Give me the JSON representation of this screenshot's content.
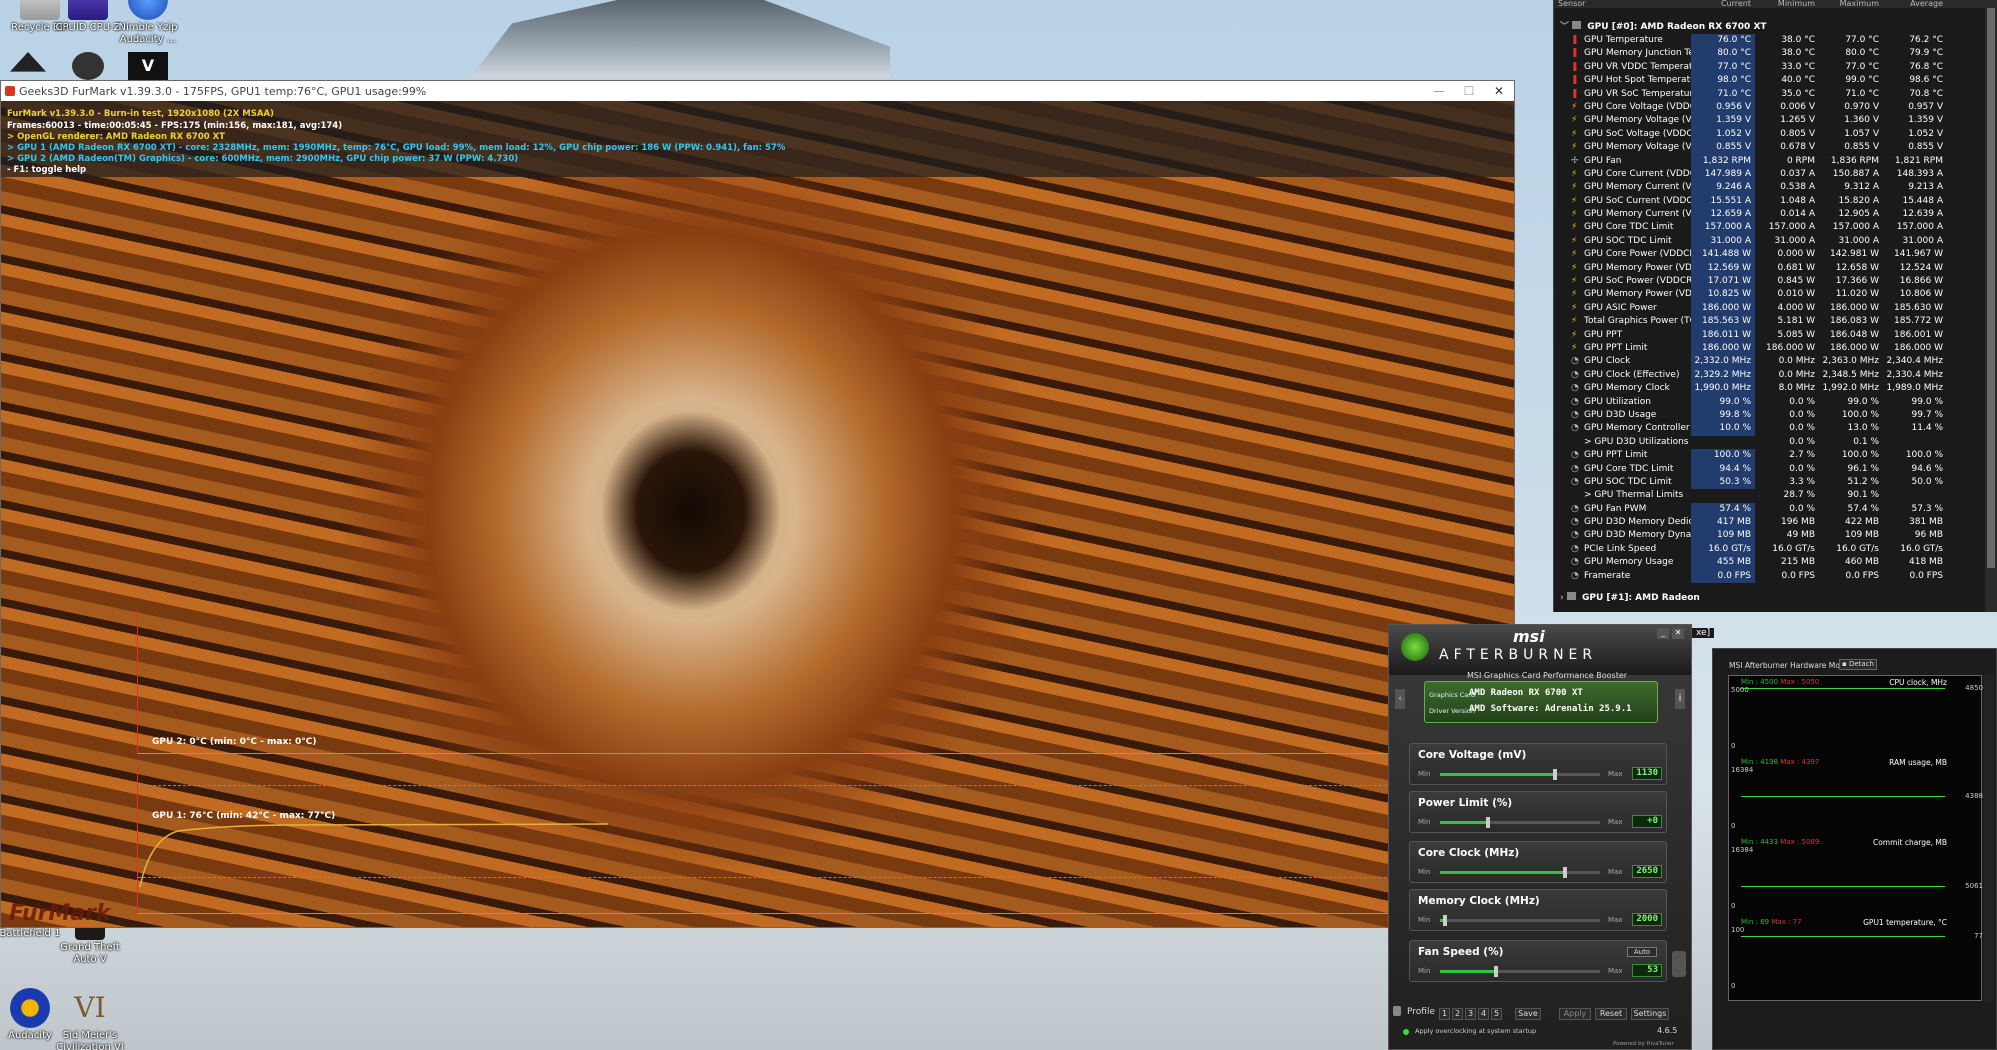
{
  "desktop": {
    "icons": [
      {
        "label": "Recycle Bin"
      },
      {
        "label": "CPUID CPU-Z"
      },
      {
        "label": "Nimble Yzip Audacity ..."
      },
      {
        "label": "Battlefield 1"
      },
      {
        "label": "Grand Theft Auto V"
      },
      {
        "label": "Audacity"
      },
      {
        "label": "Sid Meier's Civilization VI"
      }
    ]
  },
  "furmark": {
    "title": "Geeks3D FurMark v1.39.3.0 - 175FPS, GPU1 temp:76°C, GPU1 usage:99%",
    "osd": [
      {
        "text": "FurMark v1.39.3.0 - Burn-in test, 1920x1080 (2X MSAA)",
        "color": "#f2d230"
      },
      {
        "text": "Frames:60013 - time:00:05:45 - FPS:175 (min:156, max:181, avg:174)",
        "color": "#ffffff"
      },
      {
        "text": "> OpenGL renderer: AMD Radeon RX 6700 XT",
        "color": "#f2d230"
      },
      {
        "text": "> GPU 1 (AMD Radeon RX 6700 XT) - core: 2328MHz, mem: 1990MHz, temp: 76°C, GPU load: 99%, mem load: 12%, GPU chip power: 186 W (PPW: 0.941), fan: 57%",
        "color": "#33c8f0"
      },
      {
        "text": "> GPU 2 (AMD Radeon(TM) Graphics) - core: 600MHz, mem: 2900MHz, GPU chip power: 37 W (PPW: 4.730)",
        "color": "#33c8f0"
      },
      {
        "text": "- F1: toggle help",
        "color": "#ffffff"
      }
    ],
    "graph_gpu2_label": "GPU 2: 0°C (min: 0°C - max: 0°C)",
    "graph_gpu1_label": "GPU 1: 76°C (min: 42°C - max: 77°C)",
    "logo_text": "FurMark"
  },
  "hwinfo": {
    "columns": [
      "Sensor",
      "Current",
      "Minimum",
      "Maximum",
      "Average"
    ],
    "group0": "GPU [#0]: AMD Radeon RX 6700 XT",
    "group1": "GPU [#1]: AMD Radeon",
    "rows": [
      [
        "GPU Temperature",
        "76.0 °C",
        "38.0 °C",
        "77.0 °C",
        "76.2 °C",
        "temp"
      ],
      [
        "GPU Memory Junction Temp...",
        "80.0 °C",
        "38.0 °C",
        "80.0 °C",
        "79.9 °C",
        "temp"
      ],
      [
        "GPU VR VDDC Temperature",
        "77.0 °C",
        "33.0 °C",
        "77.0 °C",
        "76.8 °C",
        "temp"
      ],
      [
        "GPU Hot Spot Temperature",
        "98.0 °C",
        "40.0 °C",
        "99.0 °C",
        "98.6 °C",
        "temp"
      ],
      [
        "GPU VR SoC Temperature",
        "71.0 °C",
        "35.0 °C",
        "71.0 °C",
        "70.8 °C",
        "temp"
      ],
      [
        "GPU Core Voltage (VDDCR_...",
        "0.956 V",
        "0.006 V",
        "0.970 V",
        "0.957 V",
        "volt"
      ],
      [
        "GPU Memory Voltage (VDDIO)",
        "1.359 V",
        "1.265 V",
        "1.360 V",
        "1.359 V",
        "volt"
      ],
      [
        "GPU SoC Voltage (VDDCR_S...",
        "1.052 V",
        "0.805 V",
        "1.057 V",
        "1.052 V",
        "volt"
      ],
      [
        "GPU Memory Voltage (VDDCI...",
        "0.855 V",
        "0.678 V",
        "0.855 V",
        "0.855 V",
        "volt"
      ],
      [
        "GPU Fan",
        "1,832 RPM",
        "0 RPM",
        "1,836 RPM",
        "1,821 RPM",
        "fan"
      ],
      [
        "GPU Core Current (VDDCR_...",
        "147.989 A",
        "0.037 A",
        "150.887 A",
        "148.393 A",
        "volt"
      ],
      [
        "GPU Memory Current (VDDIO)",
        "9.246 A",
        "0.538 A",
        "9.312 A",
        "9.213 A",
        "volt"
      ],
      [
        "GPU SoC Current (VDDCR_S...",
        "15.551 A",
        "1.048 A",
        "15.820 A",
        "15.448 A",
        "volt"
      ],
      [
        "GPU Memory Current (VDDC...",
        "12.659 A",
        "0.014 A",
        "12.905 A",
        "12.639 A",
        "volt"
      ],
      [
        "GPU Core TDC Limit",
        "157.000 A",
        "157.000 A",
        "157.000 A",
        "157.000 A",
        "volt"
      ],
      [
        "GPU SOC TDC Limit",
        "31.000 A",
        "31.000 A",
        "31.000 A",
        "31.000 A",
        "volt"
      ],
      [
        "GPU Core Power (VDDCR_GFX)",
        "141.488 W",
        "0.000 W",
        "142.981 W",
        "141.967 W",
        "volt"
      ],
      [
        "GPU Memory Power (VDDIO)",
        "12.569 W",
        "0.681 W",
        "12.658 W",
        "12.524 W",
        "volt"
      ],
      [
        "GPU SoC Power (VDDCR_SOC)",
        "17.071 W",
        "0.845 W",
        "17.366 W",
        "16.866 W",
        "volt"
      ],
      [
        "GPU Memory Power (VDDCI_...",
        "10.825 W",
        "0.010 W",
        "11.020 W",
        "10.806 W",
        "volt"
      ],
      [
        "GPU ASIC Power",
        "186.000 W",
        "4.000 W",
        "186.000 W",
        "185.630 W",
        "volt"
      ],
      [
        "Total Graphics Power (TGP)",
        "185.563 W",
        "5.181 W",
        "186.083 W",
        "185.772 W",
        "volt"
      ],
      [
        "GPU PPT",
        "186.011 W",
        "5.085 W",
        "186.048 W",
        "186.001 W",
        "volt"
      ],
      [
        "GPU PPT Limit",
        "186.000 W",
        "186.000 W",
        "186.000 W",
        "186.000 W",
        "volt"
      ],
      [
        "GPU Clock",
        "2,332.0 MHz",
        "0.0 MHz",
        "2,363.0 MHz",
        "2,340.4 MHz",
        "clock"
      ],
      [
        "GPU Clock (Effective)",
        "2,329.2 MHz",
        "0.0 MHz",
        "2,348.5 MHz",
        "2,330.4 MHz",
        "clock"
      ],
      [
        "GPU Memory Clock",
        "1,990.0 MHz",
        "8.0 MHz",
        "1,992.0 MHz",
        "1,989.0 MHz",
        "clock"
      ],
      [
        "GPU Utilization",
        "99.0 %",
        "0.0 %",
        "99.0 %",
        "99.0 %",
        "clock"
      ],
      [
        "GPU D3D Usage",
        "99.8 %",
        "0.0 %",
        "100.0 %",
        "99.7 %",
        "clock"
      ],
      [
        "GPU Memory Controller Utiliz...",
        "10.0 %",
        "0.0 %",
        "13.0 %",
        "11.4 %",
        "clock"
      ],
      [
        ">  GPU D3D Utilizations",
        "",
        "0.0 %",
        "0.1 %",
        "",
        "sub"
      ],
      [
        "GPU PPT Limit",
        "100.0 %",
        "2.7 %",
        "100.0 %",
        "100.0 %",
        "clock"
      ],
      [
        "GPU Core TDC Limit",
        "94.4 %",
        "0.0 %",
        "96.1 %",
        "94.6 %",
        "clock"
      ],
      [
        "GPU SOC TDC Limit",
        "50.3 %",
        "3.3 %",
        "51.2 %",
        "50.0 %",
        "clock"
      ],
      [
        ">  GPU Thermal Limits",
        "",
        "28.7 %",
        "90.1 %",
        "",
        "sub"
      ],
      [
        "GPU Fan PWM",
        "57.4 %",
        "0.0 %",
        "57.4 %",
        "57.3 %",
        "clock"
      ],
      [
        "GPU D3D Memory Dedicated",
        "417 MB",
        "196 MB",
        "422 MB",
        "381 MB",
        "clock"
      ],
      [
        "GPU D3D Memory Dynamic",
        "109 MB",
        "49 MB",
        "109 MB",
        "96 MB",
        "clock"
      ],
      [
        "PCIe Link Speed",
        "16.0 GT/s",
        "16.0 GT/s",
        "16.0 GT/s",
        "16.0 GT/s",
        "clock"
      ],
      [
        "GPU Memory Usage",
        "455 MB",
        "215 MB",
        "460 MB",
        "418 MB",
        "clock"
      ],
      [
        "Framerate",
        "0.0 FPS",
        "0.0 FPS",
        "0.0 FPS",
        "0.0 FPS",
        "clock"
      ]
    ]
  },
  "afterburner": {
    "brand": "msi",
    "title": "AFTERBURNER",
    "subtitle": "MSI Graphics Card Performance Booster",
    "graphics_card_label": "Graphics Card",
    "graphics_card": "AMD Radeon RX 6700 XT",
    "driver_label": "Driver Version",
    "driver": "AMD Software: Adrenalin 25.9.1",
    "sliders": [
      {
        "label": "Core Voltage (mV)",
        "value": "1130",
        "level": 0.72
      },
      {
        "label": "Power Limit (%)",
        "value": "+0",
        "level": 0.3
      },
      {
        "label": "Core Clock (MHz)",
        "value": "2650",
        "level": 0.78
      },
      {
        "label": "Memory Clock (MHz)",
        "value": "2000",
        "level": 0.03
      },
      {
        "label": "Fan Speed (%)",
        "value": "53",
        "level": 0.35
      }
    ],
    "min_label": "Min",
    "max_label": "Max",
    "auto_label": "Auto",
    "profile_label": "Profile",
    "profile_slots": [
      "1",
      "2",
      "3",
      "4",
      "5"
    ],
    "save_label": "Save",
    "apply_label": "Apply",
    "reset_label": "Reset",
    "settings_label": "Settings",
    "startup_label": "Apply overclocking at system startup",
    "version": "4.6.5",
    "powered_by": "Powered by RivaTuner",
    "side_caption": "xe]"
  },
  "monitor": {
    "title": "MSI Afterburner Hardware Monitor",
    "detach_label": "Detach",
    "graphs": [
      {
        "name": "CPU clock, MHz",
        "min": "Min : 4500",
        "max": "Max : 5050",
        "top": "5000",
        "bottom": "0",
        "right": "4850"
      },
      {
        "name": "RAM usage, MB",
        "min": "Min : 4198",
        "max": "Max : 4397",
        "top": "16384",
        "bottom": "0",
        "right": "4388"
      },
      {
        "name": "Commit charge, MB",
        "min": "Min : 4433",
        "max": "Max : 5089",
        "top": "16384",
        "bottom": "0",
        "right": "5061"
      },
      {
        "name": "GPU1 temperature, °C",
        "min": "Min : 69",
        "max": "Max : 77",
        "top": "100",
        "bottom": "0",
        "right": "77"
      }
    ]
  },
  "colors": {
    "hw_current_bg": "#223c6e",
    "ab_accent": "#35c23f",
    "fm_osd_yellow": "#f2d230",
    "fm_osd_cyan": "#33c8f0"
  }
}
